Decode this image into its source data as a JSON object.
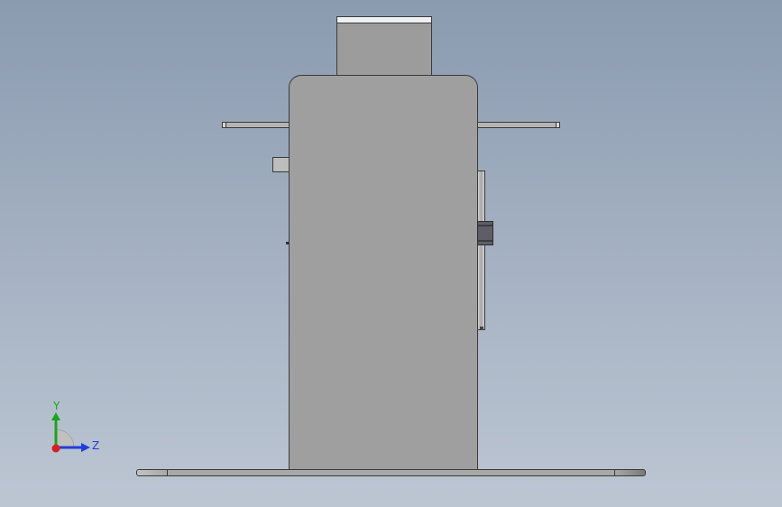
{
  "triad": {
    "y_label": "Y",
    "z_label": "Z",
    "colors": {
      "y": "#1aa51a",
      "z": "#1f3fd8",
      "x": "#d81e1e",
      "arc": "#c0c0c0"
    }
  },
  "colors": {
    "bg_top": "#8a9bb0",
    "bg_bottom": "#bcc6d3",
    "body": "#9f9f9f",
    "edge": "#3a3a3a",
    "clamp": "#5e5e66"
  }
}
